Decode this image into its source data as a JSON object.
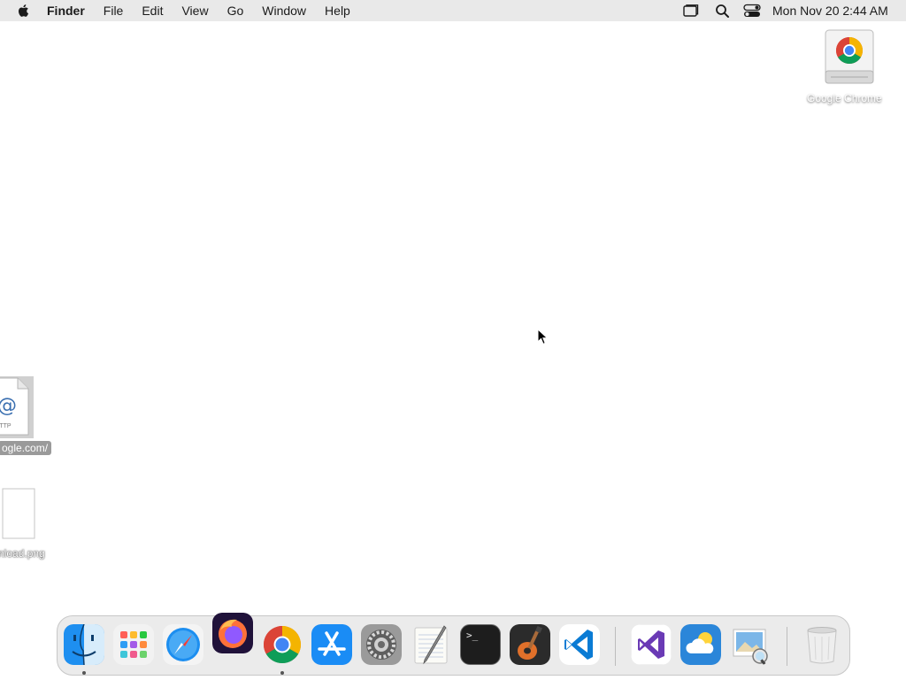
{
  "menubar": {
    "apple_icon": "apple-icon",
    "items": [
      {
        "label": "Finder",
        "bold": true
      },
      {
        "label": "File"
      },
      {
        "label": "Edit"
      },
      {
        "label": "View"
      },
      {
        "label": "Go"
      },
      {
        "label": "Window"
      },
      {
        "label": "Help"
      }
    ],
    "status_icons": [
      "window-mirroring-icon",
      "spotlight-search-icon",
      "control-center-icon"
    ],
    "clock": "Mon Nov 20  2:44 AM"
  },
  "desktop": {
    "items": [
      {
        "label": "Google Chrome",
        "icon": "chrome-disk-image-icon"
      },
      {
        "label": "ogle.com/",
        "icon": "webloc-file-icon",
        "selected": true
      },
      {
        "label": "nload.png",
        "icon": "png-file-icon"
      }
    ]
  },
  "dock": {
    "apps": [
      {
        "name": "Finder",
        "icon": "finder-icon",
        "running": true
      },
      {
        "name": "Launchpad",
        "icon": "launchpad-icon"
      },
      {
        "name": "Safari",
        "icon": "safari-icon"
      },
      {
        "name": "Firefox",
        "icon": "firefox-icon"
      },
      {
        "name": "Google Chrome",
        "icon": "chrome-icon",
        "running": true
      },
      {
        "name": "App Store",
        "icon": "app-store-icon"
      },
      {
        "name": "System Settings",
        "icon": "system-settings-icon"
      },
      {
        "name": "TextEdit",
        "icon": "textedit-icon"
      },
      {
        "name": "Terminal",
        "icon": "terminal-icon"
      },
      {
        "name": "GarageBand",
        "icon": "garageband-icon"
      },
      {
        "name": "Visual Studio Code",
        "icon": "vscode-icon"
      },
      {
        "name": "Visual Studio",
        "icon": "visual-studio-icon"
      },
      {
        "name": "Weather",
        "icon": "weather-icon"
      },
      {
        "name": "Preview",
        "icon": "preview-icon"
      },
      {
        "name": "Trash",
        "icon": "trash-icon"
      }
    ],
    "terminal_glyph": ">_"
  },
  "colors": {
    "menubar_bg": "#e9e9e9",
    "desktop_bg": "#ffffff",
    "chrome_red": "#db4437",
    "chrome_yellow": "#f4b400",
    "chrome_green": "#0f9d58",
    "chrome_blue": "#4285f4",
    "vscode_blue": "#0a7bd4",
    "vs_purple": "#6a3ab5"
  }
}
